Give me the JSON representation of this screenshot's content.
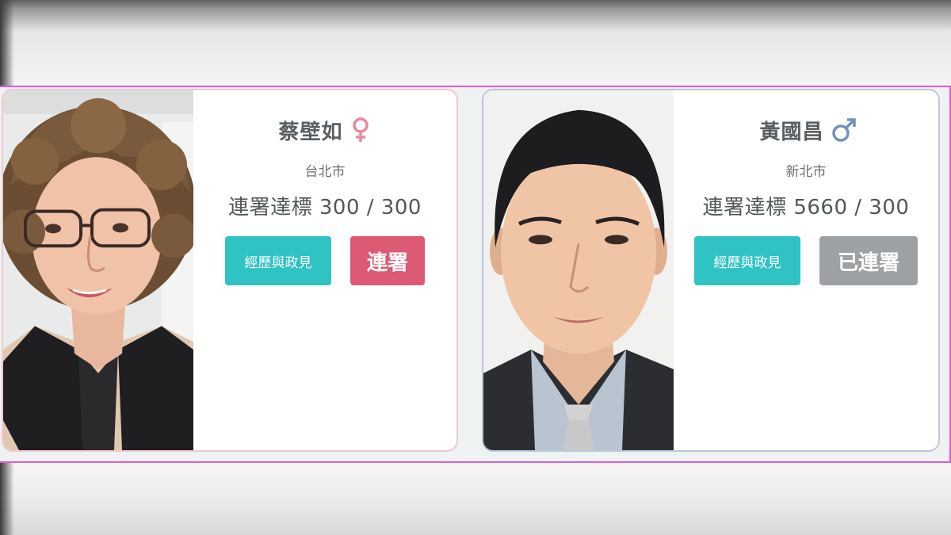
{
  "colors": {
    "accent_teal": "#2fc3c4",
    "sign_red": "#dd5a74",
    "signed_gray": "#9ea1a4",
    "female_symbol": "#e58aa0",
    "male_symbol": "#6f93bd",
    "strip_outline": "#e05bd6"
  },
  "candidates": [
    {
      "name": "蔡壁如",
      "gender_icon": "female-symbol-icon",
      "city": "台北市",
      "signature_label": "連署達標",
      "signature_count": "300 / 300",
      "profile_button": "經歷與政見",
      "action_button": "連署",
      "action_state": "available"
    },
    {
      "name": "黃國昌",
      "gender_icon": "male-symbol-icon",
      "city": "新北市",
      "signature_label": "連署達標",
      "signature_count": "5660 / 300",
      "profile_button": "經歷與政見",
      "action_button": "已連署",
      "action_state": "signed"
    }
  ]
}
